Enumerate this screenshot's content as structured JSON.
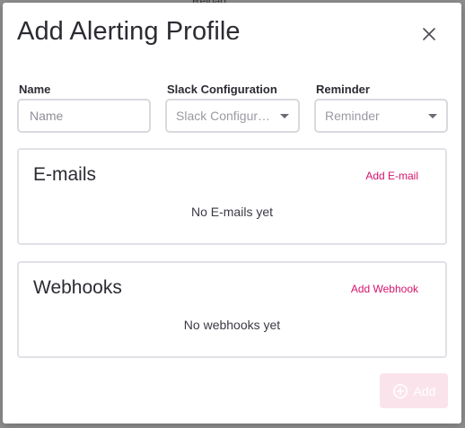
{
  "backdrop": {
    "peek_text": "Reload"
  },
  "dialog": {
    "title": "Add Alerting Profile"
  },
  "fields": {
    "name": {
      "label": "Name",
      "placeholder": "Name",
      "value": ""
    },
    "slack": {
      "label": "Slack Configuration",
      "placeholder": "Slack Configuration"
    },
    "reminder": {
      "label": "Reminder",
      "placeholder": "Reminder"
    }
  },
  "sections": {
    "emails": {
      "title": "E-mails",
      "action_label": "Add E-mail",
      "empty_text": "No E-mails yet"
    },
    "webhooks": {
      "title": "Webhooks",
      "action_label": "Add Webhook",
      "empty_text": "No webhooks yet"
    }
  },
  "footer": {
    "add_label": "Add"
  },
  "colors": {
    "accent": "#d6136e",
    "disabled_button": "#fbe3ec"
  },
  "icons": {
    "close": "close-icon",
    "add": "plus-circle-icon",
    "dropdown": "chevron-down-icon"
  }
}
